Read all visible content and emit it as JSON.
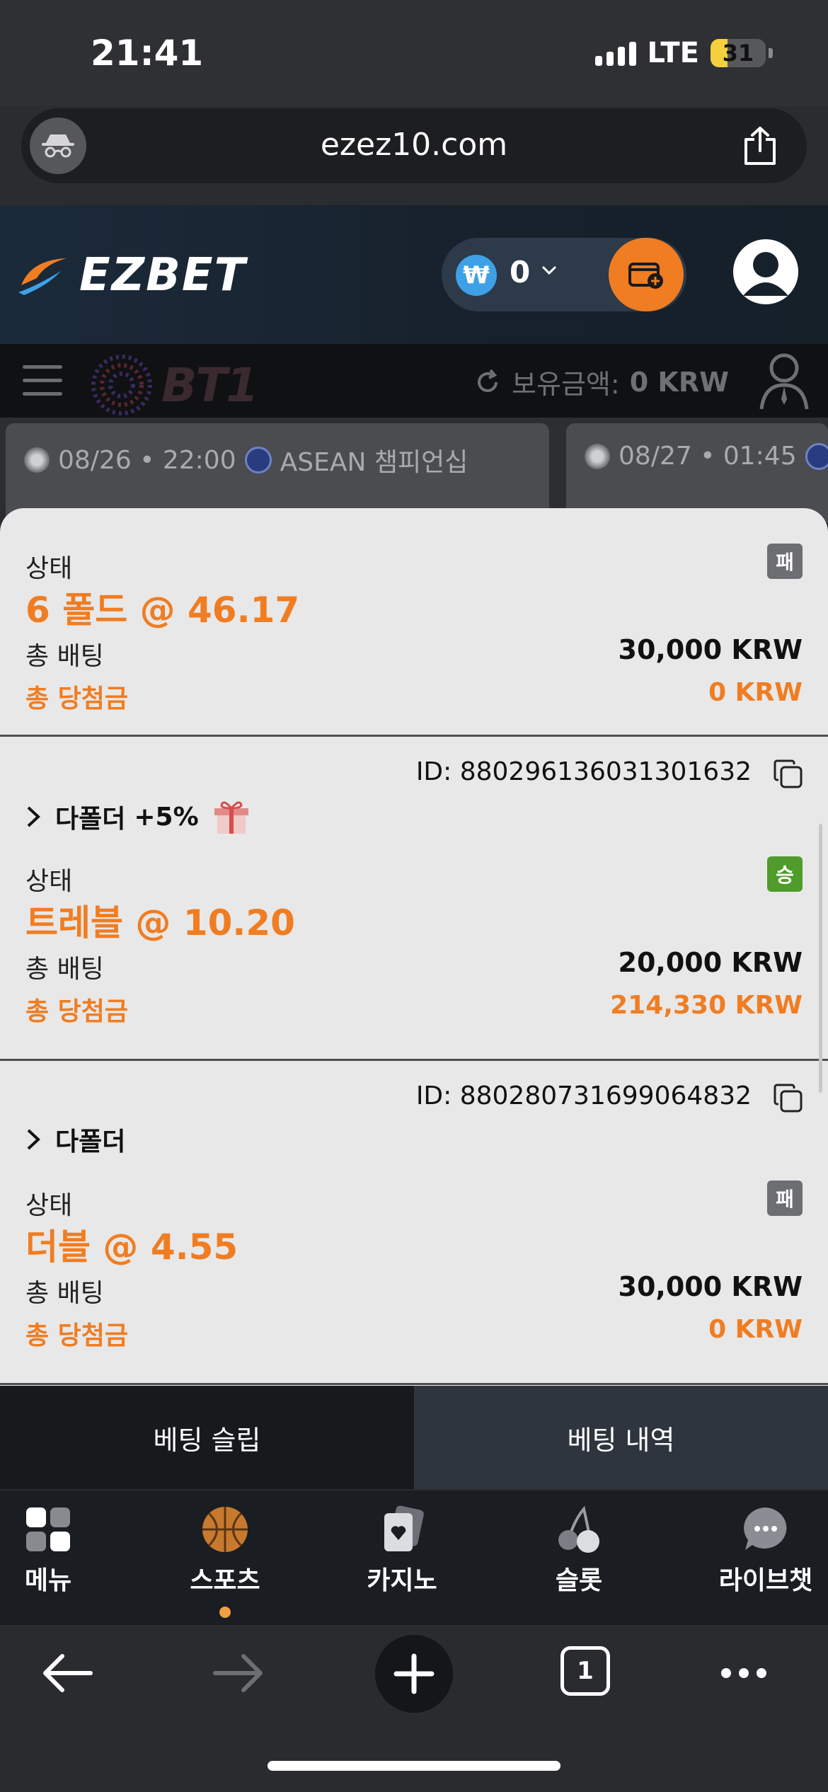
{
  "status_bar": {
    "time": "21:41",
    "network": "LTE",
    "battery": "31",
    "battery_level": 0.31
  },
  "browser": {
    "url": "ezez10.com",
    "tab_count": "1"
  },
  "header": {
    "logo_text": "EZBET",
    "wallet_currency_symbol": "₩",
    "wallet_amount": "0"
  },
  "banner": {
    "logo_text": "BT1",
    "balance_label": "보유금액:",
    "balance_value": "0 KRW"
  },
  "matches": [
    {
      "datetime": "08/26 • 22:00",
      "league": "ASEAN 챔피언십"
    },
    {
      "datetime": "08/27 • 01:45",
      "league": ""
    }
  ],
  "bets": [
    {
      "status_label": "상태",
      "status_badge": "패",
      "fold": "6 폴드 @  46.17",
      "total_bet_label": "총 배팅",
      "total_bet": "30,000 KRW",
      "win_label": "총 당첨금",
      "win_amount": "0 KRW"
    },
    {
      "id": "ID: 880296136031301632",
      "type": "다폴더",
      "bonus": "+5%",
      "status_label": "상태",
      "status_badge": "승",
      "fold": "트레블 @  10.20",
      "total_bet_label": "총 배팅",
      "total_bet": "20,000 KRW",
      "win_label": "총 당첨금",
      "win_amount": "214,330 KRW"
    },
    {
      "id": "ID: 880280731699064832",
      "type": "다폴더",
      "status_label": "상태",
      "status_badge": "패",
      "fold": "더블 @  4.55",
      "total_bet_label": "총 배팅",
      "total_bet": "30,000 KRW",
      "win_label": "총 당첨금",
      "win_amount": "0 KRW"
    }
  ],
  "bet_tabs": {
    "slip": "베팅 슬립",
    "history": "베팅 내역"
  },
  "nav": {
    "items": [
      {
        "label": "메뉴",
        "icon": "grid-icon"
      },
      {
        "label": "스포츠",
        "icon": "basketball-icon"
      },
      {
        "label": "카지노",
        "icon": "cards-icon"
      },
      {
        "label": "슬롯",
        "icon": "cherry-icon"
      },
      {
        "label": "라이브챗",
        "icon": "chat-icon"
      }
    ],
    "active": "스포츠"
  },
  "colors": {
    "accent": "#f07d22",
    "win_badge": "#4f9b2b",
    "lose_badge": "#6d6e72"
  }
}
